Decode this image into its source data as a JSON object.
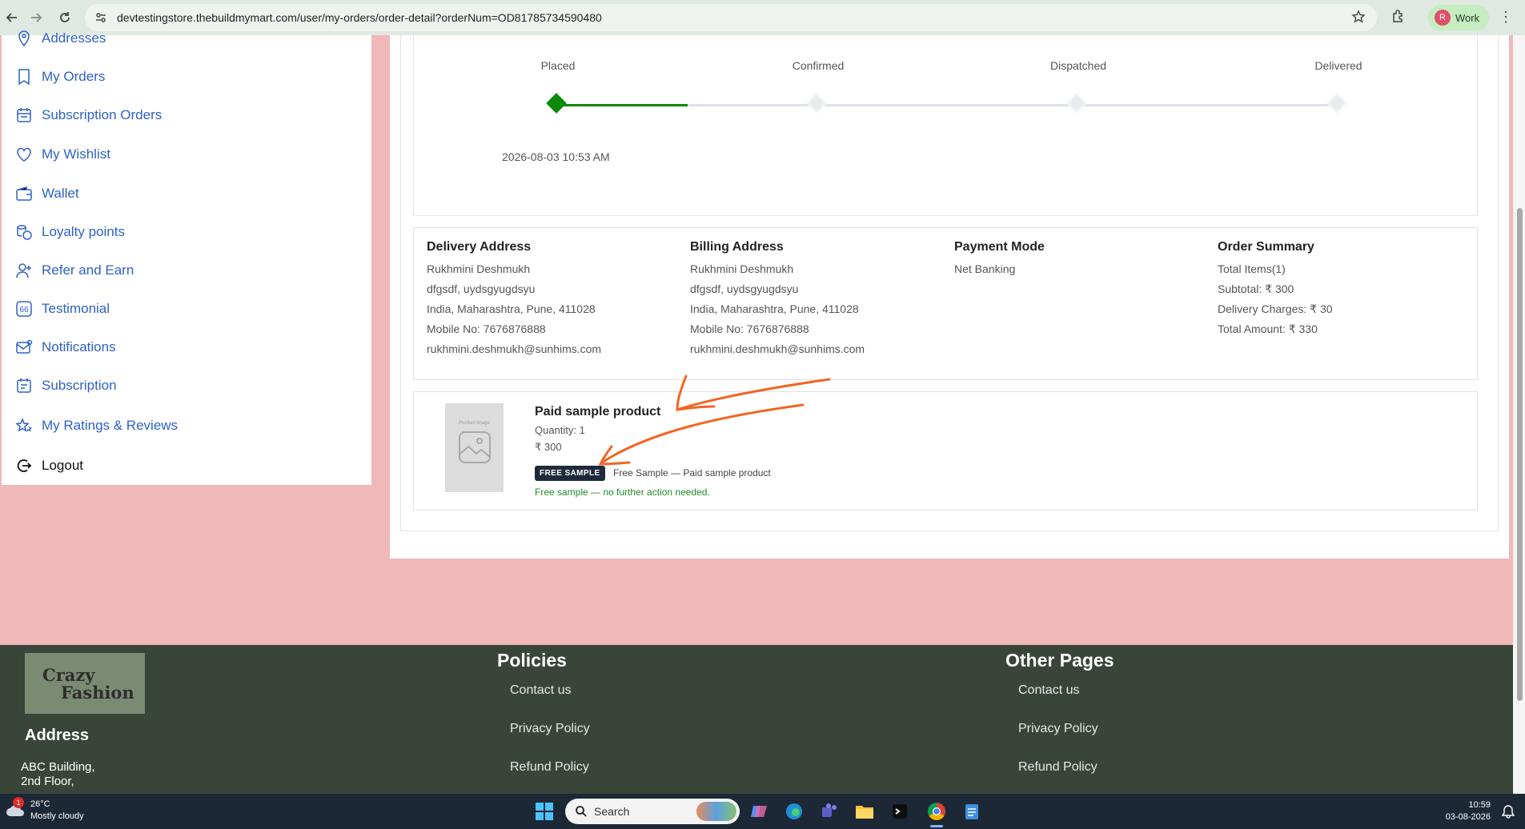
{
  "browser": {
    "url": "devtestingstore.thebuildmymart.com/user/my-orders/order-detail?orderNum=OD81785734590480",
    "profile_label": "Work",
    "profile_initial": "R"
  },
  "sidebar": {
    "items": [
      {
        "label": "Addresses",
        "icon": "location-pin-icon"
      },
      {
        "label": "My Orders",
        "icon": "bookmark-icon"
      },
      {
        "label": "Subscription Orders",
        "icon": "calendar-icon"
      },
      {
        "label": "My Wishlist",
        "icon": "heart-icon"
      },
      {
        "label": "Wallet",
        "icon": "wallet-icon"
      },
      {
        "label": "Loyalty points",
        "icon": "coins-icon"
      },
      {
        "label": "Refer and Earn",
        "icon": "user-plus-icon"
      },
      {
        "label": "Testimonial",
        "icon": "quote-icon"
      },
      {
        "label": "Notifications",
        "icon": "mail-icon"
      },
      {
        "label": "Subscription",
        "icon": "calendar-list-icon"
      },
      {
        "label": "My Ratings & Reviews",
        "icon": "stars-icon"
      },
      {
        "label": "Logout",
        "icon": "logout-icon"
      }
    ]
  },
  "tracker": {
    "steps": [
      "Placed",
      "Confirmed",
      "Dispatched",
      "Delivered"
    ],
    "completed_steps": 1,
    "placed_date": "2026-08-03 10:53 AM",
    "done_color": "#0a8a0a"
  },
  "delivery": {
    "title": "Delivery Address",
    "name": "Rukhmini Deshmukh",
    "line1": "dfgsdf, uydsgyugdsyu",
    "line2": "India, Maharashtra, Pune, 411028",
    "mobile": "Mobile No: 7676876888",
    "email": "rukhmini.deshmukh@sunhims.com"
  },
  "billing": {
    "title": "Billing Address",
    "name": "Rukhmini Deshmukh",
    "line1": "dfgsdf, uydsgyugdsyu",
    "line2": "India, Maharashtra, Pune, 411028",
    "mobile": "Mobile No: 7676876888",
    "email": "rukhmini.deshmukh@sunhims.com"
  },
  "payment": {
    "title": "Payment Mode",
    "mode": "Net Banking"
  },
  "summary": {
    "title": "Order Summary",
    "total_items": "Total Items(1)",
    "subtotal": "Subtotal: ₹ 300",
    "delivery": "Delivery Charges: ₹ 30",
    "total": "Total Amount: ₹ 330"
  },
  "product": {
    "image_placeholder": "Product image",
    "name": "Paid sample product",
    "quantity": "Quantity: 1",
    "price": "₹ 300",
    "badge": "FREE SAMPLE",
    "badge_note": "Free Sample — Paid sample product",
    "free_note": "Free sample — no further action needed.",
    "free_note_color": "#1f8a2a"
  },
  "annotation_color": "#f26522",
  "footer": {
    "logo_line1": "Crazy",
    "logo_line2": "Fashion",
    "address_title": "Address",
    "address_line1": "ABC Building,",
    "address_line2": "2nd Floor,",
    "policies_title": "Policies",
    "policies_links": [
      "Contact us",
      "Privacy Policy",
      "Refund Policy"
    ],
    "other_title": "Other Pages",
    "other_links": [
      "Contact us",
      "Privacy Policy",
      "Refund Policy"
    ]
  },
  "taskbar": {
    "weather_temp": "26°C",
    "weather_desc": "Mostly cloudy",
    "weather_badge": "1",
    "search_label": "Search",
    "time": "10:59",
    "date": "03-08-2026"
  }
}
